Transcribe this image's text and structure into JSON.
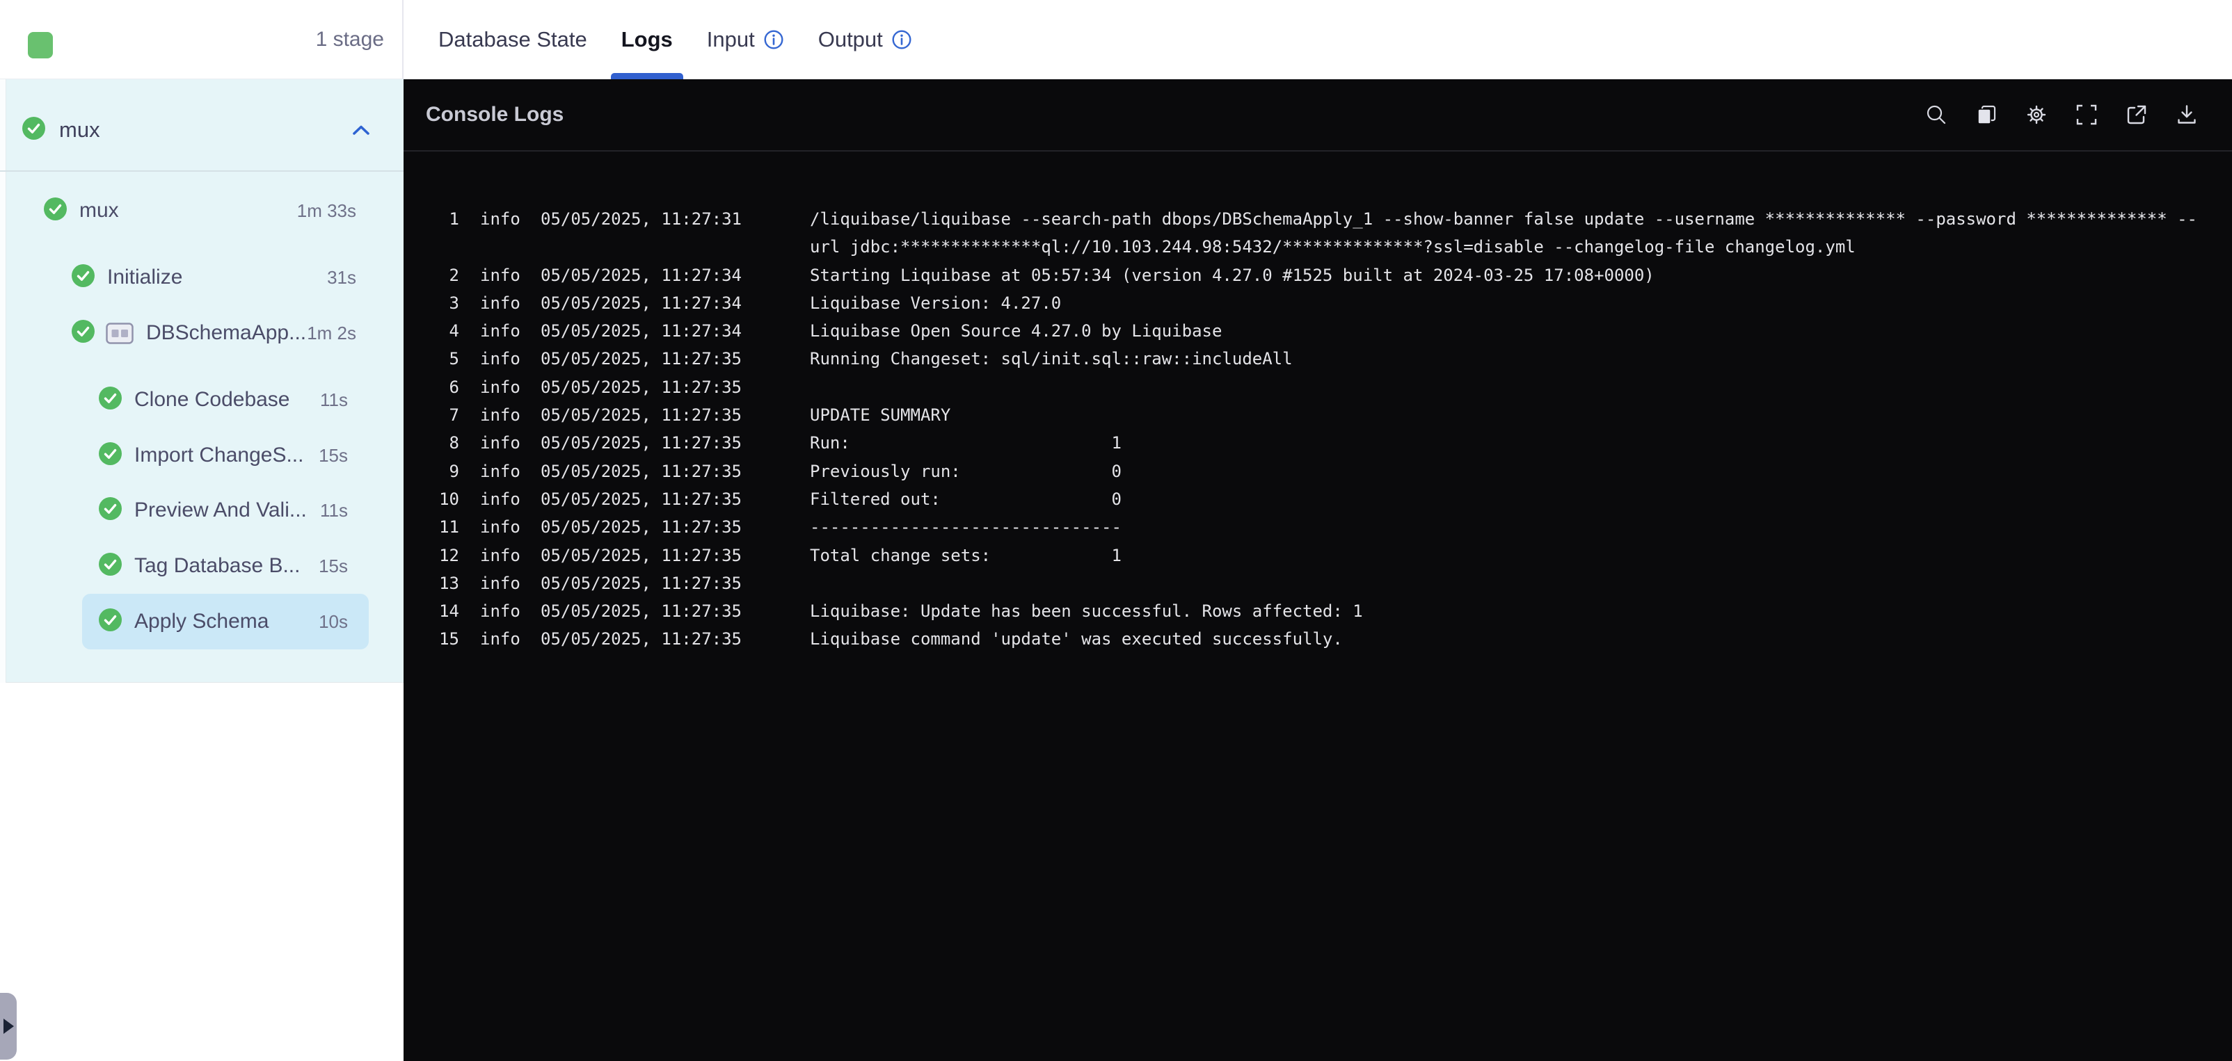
{
  "header": {
    "stage_count_label": "1 stage"
  },
  "tabs": {
    "database_state": "Database State",
    "logs": "Logs",
    "input": "Input",
    "output": "Output"
  },
  "sidebar": {
    "section": {
      "name": "mux",
      "status": "success"
    },
    "root": {
      "name": "mux",
      "duration": "1m 33s",
      "status": "success"
    },
    "items": [
      {
        "label": "Initialize",
        "duration": "31s",
        "status": "success"
      },
      {
        "label": "DBSchemaApp...",
        "duration": "1m 2s",
        "status": "success"
      },
      {
        "label": "Clone Codebase",
        "duration": "11s",
        "status": "success"
      },
      {
        "label": "Import ChangeS...",
        "duration": "15s",
        "status": "success"
      },
      {
        "label": "Preview And Vali...",
        "duration": "11s",
        "status": "success"
      },
      {
        "label": "Tag Database B...",
        "duration": "15s",
        "status": "success"
      },
      {
        "label": "Apply Schema",
        "duration": "10s",
        "status": "success",
        "selected": true
      }
    ]
  },
  "console": {
    "title": "Console Logs",
    "toolbar_icons": [
      "search",
      "copy",
      "settings",
      "fullscreen",
      "open-in-new",
      "download"
    ],
    "logs": [
      {
        "n": "1",
        "level": "info",
        "ts": "05/05/2025, 11:27:31",
        "msg": "/liquibase/liquibase --search-path dbops/DBSchemaApply_1 --show-banner false update --username ************** --password ************** --url jdbc:**************ql://10.103.244.98:5432/**************?ssl=disable --changelog-file changelog.yml"
      },
      {
        "n": "2",
        "level": "info",
        "ts": "05/05/2025, 11:27:34",
        "msg": "Starting Liquibase at 05:57:34 (version 4.27.0 #1525 built at 2024-03-25 17:08+0000)"
      },
      {
        "n": "3",
        "level": "info",
        "ts": "05/05/2025, 11:27:34",
        "msg": "Liquibase Version: 4.27.0"
      },
      {
        "n": "4",
        "level": "info",
        "ts": "05/05/2025, 11:27:34",
        "msg": "Liquibase Open Source 4.27.0 by Liquibase"
      },
      {
        "n": "5",
        "level": "info",
        "ts": "05/05/2025, 11:27:35",
        "msg": "Running Changeset: sql/init.sql::raw::includeAll"
      },
      {
        "n": "6",
        "level": "info",
        "ts": "05/05/2025, 11:27:35",
        "msg": ""
      },
      {
        "n": "7",
        "level": "info",
        "ts": "05/05/2025, 11:27:35",
        "msg": "UPDATE SUMMARY"
      },
      {
        "n": "8",
        "level": "info",
        "ts": "05/05/2025, 11:27:35",
        "msg": "Run:                          1"
      },
      {
        "n": "9",
        "level": "info",
        "ts": "05/05/2025, 11:27:35",
        "msg": "Previously run:               0"
      },
      {
        "n": "10",
        "level": "info",
        "ts": "05/05/2025, 11:27:35",
        "msg": "Filtered out:                 0"
      },
      {
        "n": "11",
        "level": "info",
        "ts": "05/05/2025, 11:27:35",
        "msg": "-------------------------------"
      },
      {
        "n": "12",
        "level": "info",
        "ts": "05/05/2025, 11:27:35",
        "msg": "Total change sets:            1"
      },
      {
        "n": "13",
        "level": "info",
        "ts": "05/05/2025, 11:27:35",
        "msg": ""
      },
      {
        "n": "14",
        "level": "info",
        "ts": "05/05/2025, 11:27:35",
        "msg": "Liquibase: Update has been successful. Rows affected: 1"
      },
      {
        "n": "15",
        "level": "info",
        "ts": "05/05/2025, 11:27:35",
        "msg": "Liquibase command 'update' was executed successfully."
      }
    ]
  },
  "colors": {
    "accent_blue": "#3160cf",
    "success_green": "#53b961",
    "console_bg": "#0a0a0c",
    "sidebar_bg": "#e6f5f8",
    "selected_row_bg": "#cbe8f7",
    "stage_square_green": "#69c16f"
  }
}
